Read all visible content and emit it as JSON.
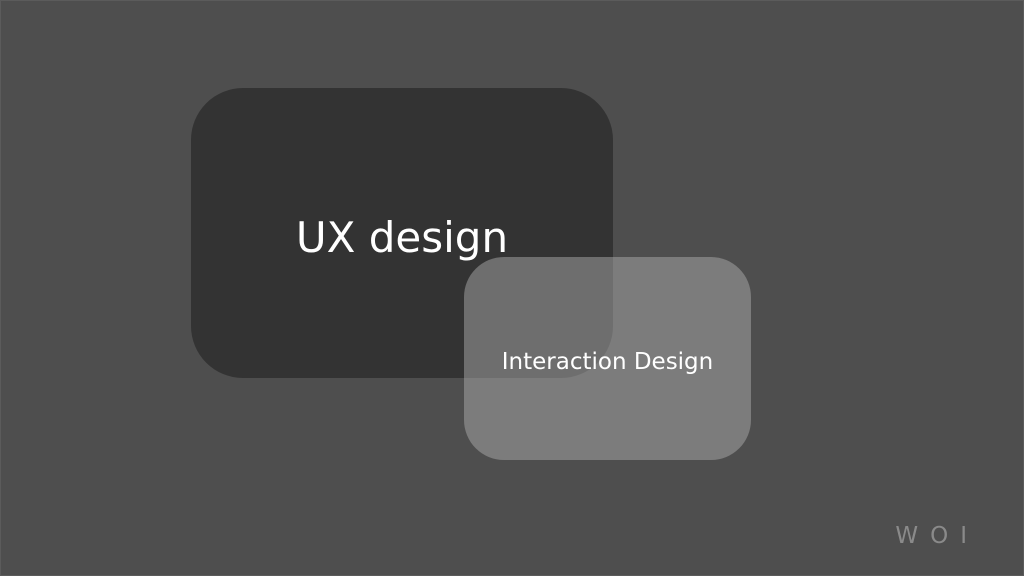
{
  "colors": {
    "background": "#4e4e4e",
    "ux_box": "#333333",
    "interaction_box": "#aaaaaa",
    "brand_text": "#8a8a8a"
  },
  "nodes": {
    "ux": {
      "label": "UX design"
    },
    "interaction": {
      "label": "Interaction Design"
    }
  },
  "brand": {
    "text": "WOI"
  }
}
